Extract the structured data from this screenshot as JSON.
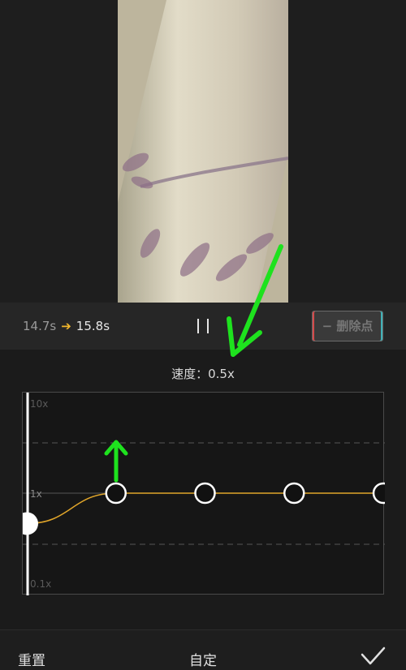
{
  "preview": {
    "description_icon": "video-frame"
  },
  "controls": {
    "time_start": "14.7s",
    "time_arrow": "➔",
    "time_end": "15.8s",
    "pause_icon": "pause-icon",
    "delete_point_label": "− 删除点"
  },
  "speed": {
    "label": "速度：0.5x"
  },
  "curve": {
    "ticks": [
      "10x",
      "1x",
      "0.1x"
    ],
    "points": [
      {
        "time_fraction": 0.0,
        "speed_x": 0.5,
        "selected": true
      },
      {
        "time_fraction": 0.25,
        "speed_x": 1,
        "selected": false
      },
      {
        "time_fraction": 0.5,
        "speed_x": 1,
        "selected": false
      },
      {
        "time_fraction": 0.75,
        "speed_x": 1,
        "selected": false
      },
      {
        "time_fraction": 1.0,
        "speed_x": 1,
        "selected": false
      }
    ],
    "line_color": "#e0a52a",
    "playhead_color": "#ffffff"
  },
  "bottom": {
    "reset_label": "重置",
    "title": "自定",
    "confirm_icon": "checkmark-icon"
  },
  "annotation": {
    "arrow_color": "#1ee21e"
  }
}
